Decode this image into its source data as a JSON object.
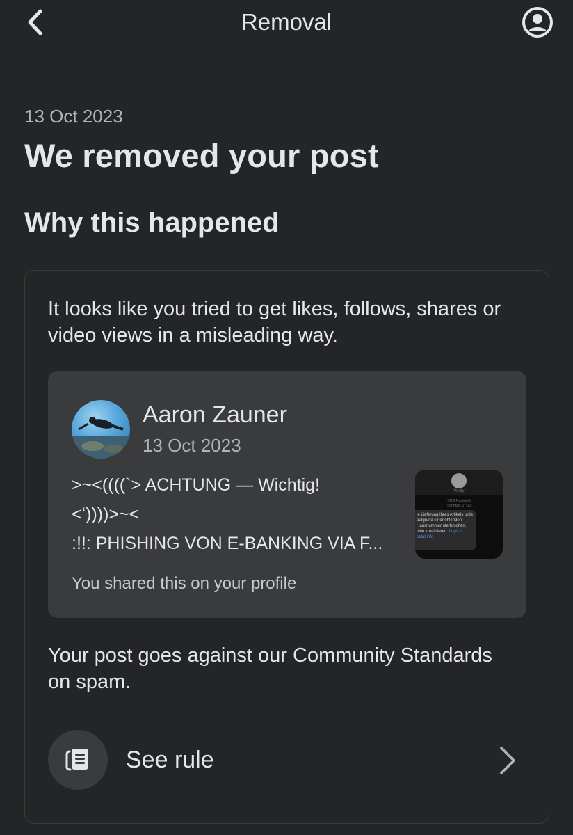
{
  "topbar": {
    "title": "Removal",
    "back_icon": "chevron-left-icon",
    "profile_icon": "user-circle-icon"
  },
  "notice": {
    "date": "13 Oct 2023",
    "headline": "We removed your post",
    "section_title": "Why this happened",
    "reason": "It looks like you tried to get likes, follows, shares or video views in a misleading way.",
    "policy": "Your post goes against our Community Standards on spam."
  },
  "post": {
    "author": "Aaron Zauner",
    "date": "13 Oct 2023",
    "lines": [
      ">~<((((`>  ACHTUNG — Wichtig!",
      "<‘))))>~<",
      ":!!: PHISHING VON E-BANKING VIA F..."
    ],
    "shared_note": "You shared this on your profile",
    "thumbnail": {
      "sender": "Verify",
      "header": "SMS-Nachricht",
      "time": "Sonntag, 17:00",
      "message": "ie Lieferung Ihres Artikels urde aufgrund einer ehlenden Hausnummer nterbrochen. bitte ktualisieren:",
      "link": "https:// ostat.info"
    }
  },
  "rule": {
    "label": "See rule",
    "icon": "rulebook-icon",
    "chevron_icon": "chevron-right-icon"
  },
  "colors": {
    "background": "#242526",
    "card": "#3a3b3c",
    "text": "#e4e6eb",
    "muted": "#b0b3b8"
  }
}
